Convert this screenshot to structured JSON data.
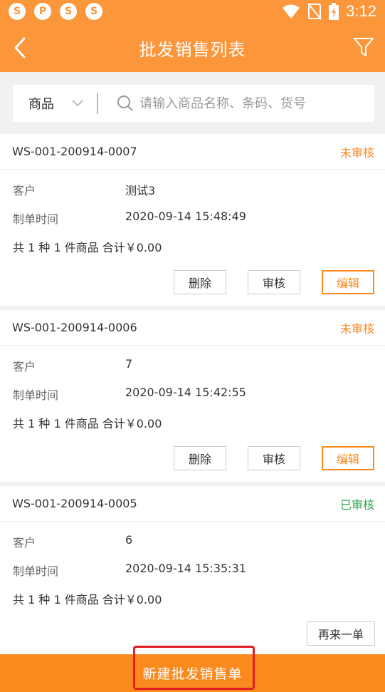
{
  "status_bar": {
    "time": "3:12",
    "icons": [
      "app-notification-icon",
      "message-icon",
      "app-notification-icon",
      "app-notification-icon"
    ],
    "right_icons": [
      "wifi-icon",
      "no-sim-icon",
      "battery-charging-icon"
    ]
  },
  "header": {
    "title": "批发销售列表",
    "back_icon": "chevron-left-icon",
    "filter_icon": "filter-icon",
    "background": "#fb963a"
  },
  "search": {
    "category": "商品",
    "placeholder": "请输入商品名称、条码、货号"
  },
  "orders": [
    {
      "order_no": "WS-001-200914-0007",
      "status": "未审核",
      "customer_label": "客户",
      "customer": "测试3",
      "time_label": "制单时间",
      "time": "2020-09-14 15:48:49",
      "summary": "共 1 种 1 件商品 合计￥0.00",
      "buttons": [
        "删除",
        "审核",
        "编辑"
      ]
    },
    {
      "order_no": "WS-001-200914-0006",
      "status": "未审核",
      "customer_label": "客户",
      "customer": "7",
      "time_label": "制单时间",
      "time": "2020-09-14 15:42:55",
      "summary": "共 1 种 1 件商品 合计￥0.00",
      "buttons": [
        "删除",
        "审核",
        "编辑"
      ]
    },
    {
      "order_no": "WS-001-200914-0005",
      "status": "已审核",
      "customer_label": "客户",
      "customer": "6",
      "time_label": "制单时间",
      "time": "2020-09-14 15:35:31",
      "summary": "共 1 种 1 件商品 合计￥0.00",
      "buttons": [
        "再来一单"
      ]
    }
  ],
  "bottom": {
    "new_label": "新建批发销售单"
  },
  "colors": {
    "accent": "#fb8a1e",
    "pending": "#fb8a1e",
    "approved": "#2fa84f",
    "highlight": "#e31e24"
  }
}
